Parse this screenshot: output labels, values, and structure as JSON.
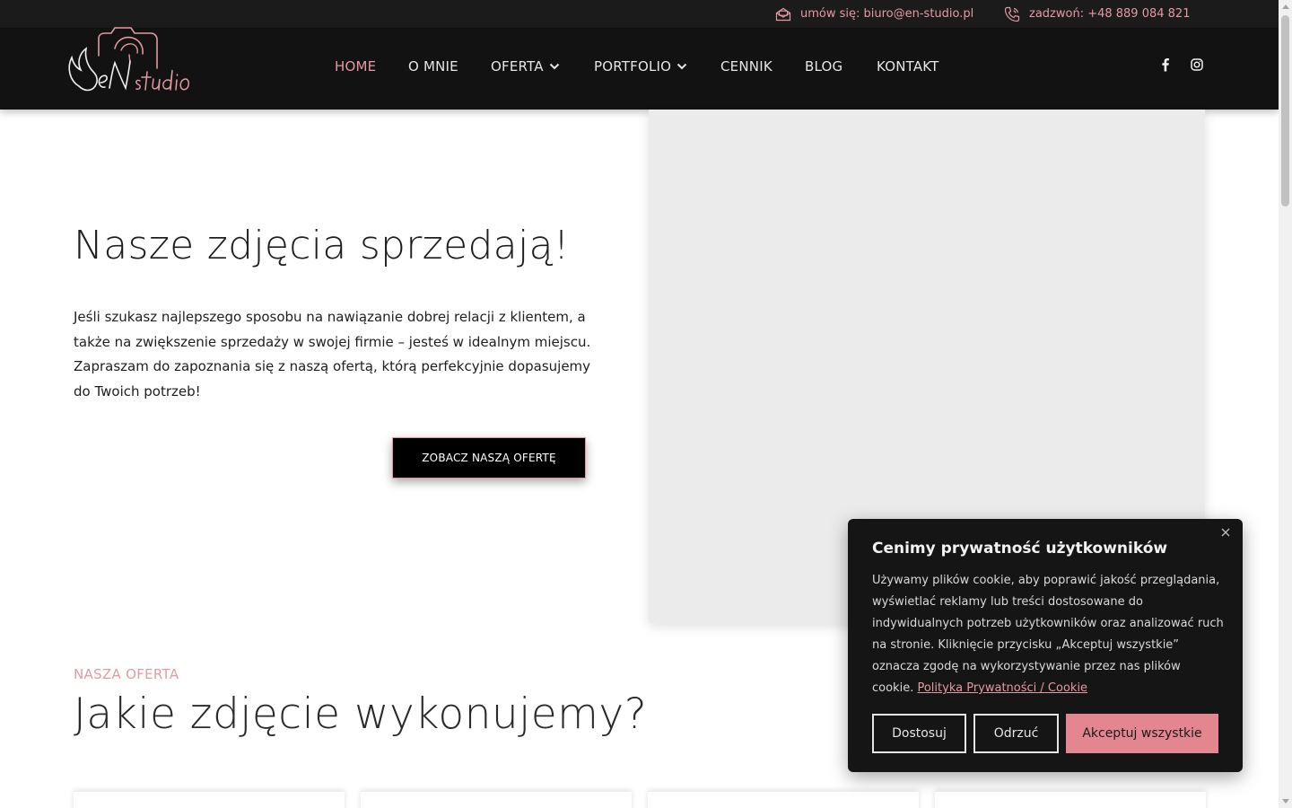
{
  "topbar": {
    "email_text": "umów się: biuro@en-studio.pl",
    "phone_text": "zadzwoń: +48 889 084 821",
    "email_icon": "envelope-icon",
    "phone_icon": "phone-icon"
  },
  "header": {
    "logo_text": "eN studio",
    "nav": {
      "home": "HOME",
      "about": "O MNIE",
      "offer": "OFERTA",
      "portfolio": "PORTFOLIO",
      "pricing": "CENNIK",
      "blog": "BLOG",
      "contact": "KONTAKT"
    },
    "social_icons": [
      "facebook-icon",
      "instagram-icon"
    ]
  },
  "hero": {
    "title": "Nasze zdjęcia sprzedają!",
    "line1": "Jeśli szukasz najlepszego sposobu na nawiązanie dobrej relacji z klientem, a",
    "line2": "także na zwiększenie sprzedaży w swojej firmie – jesteś w idealnym miejscu.",
    "line3": "Zapraszam do zapoznania się z naszą ofertą, którą perfekcyjnie dopasujemy",
    "line4": "do Twoich potrzeb!",
    "cta": "ZOBACZ NASZĄ OFERTĘ"
  },
  "offer_section": {
    "kicker": "NASZA OFERTA",
    "title": "Jakie zdjęcie wykonujemy?"
  },
  "cookie": {
    "title": "Cenimy prywatność użytkowników",
    "text": "Używamy plików cookie, aby poprawić jakość przeglądania, wyświetlać reklamy lub treści dostosowane do indywidualnych potrzeb użytkowników oraz analizować ruch na stronie. Kliknięcie przycisku „Akceptuj wszystkie” oznacza zgodę na wykorzystywanie przez nas plików cookie.",
    "link": "Polityka Prywatności / Cookie",
    "customize": "Dostosuj",
    "reject": "Odrzuć",
    "accept": "Akceptuj wszystkie"
  },
  "colors": {
    "accent": "#e39aa3",
    "header_bg": "#121212",
    "accept_bg": "#e3868f"
  }
}
